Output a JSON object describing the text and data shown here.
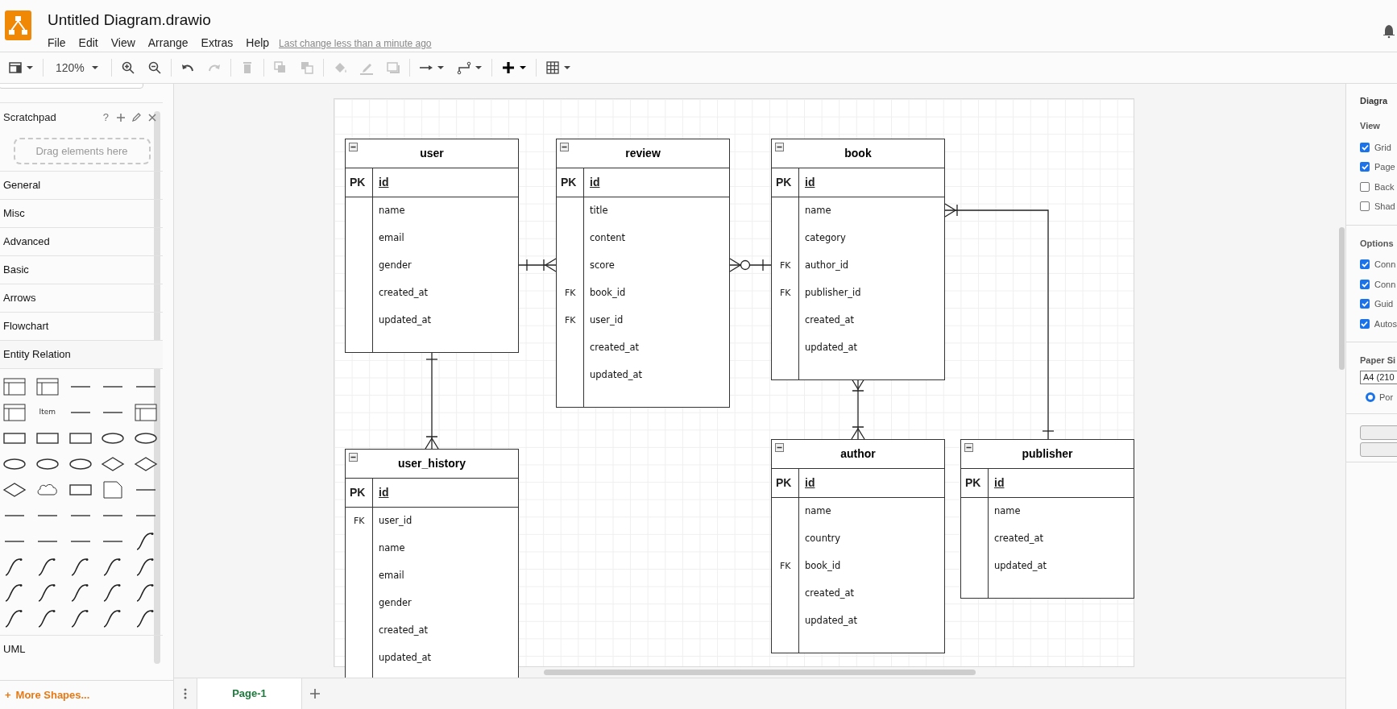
{
  "app": {
    "title": "Untitled Diagram.drawio",
    "menu": [
      "File",
      "Edit",
      "View",
      "Arrange",
      "Extras",
      "Help"
    ],
    "last_change": "Last change less than a minute ago"
  },
  "toolbar": {
    "zoom": "120%",
    "groups": [
      [
        {
          "kind": "layout",
          "disabled": false
        }
      ],
      [
        {
          "kind": "zoom-menu",
          "disabled": false
        }
      ],
      [
        {
          "kind": "zoom-in",
          "disabled": false
        },
        {
          "kind": "zoom-out",
          "disabled": false
        }
      ],
      [
        {
          "kind": "undo",
          "disabled": false
        },
        {
          "kind": "redo",
          "disabled": true
        }
      ],
      [
        {
          "kind": "delete",
          "disabled": true
        }
      ],
      [
        {
          "kind": "to-front",
          "disabled": true
        },
        {
          "kind": "to-back",
          "disabled": true
        }
      ],
      [
        {
          "kind": "fill",
          "disabled": true
        },
        {
          "kind": "line-color",
          "disabled": true
        },
        {
          "kind": "shadow",
          "disabled": true
        }
      ],
      [
        {
          "kind": "connection",
          "disabled": false
        },
        {
          "kind": "waypoints",
          "disabled": false
        }
      ],
      [
        {
          "kind": "insert",
          "disabled": false
        }
      ],
      [
        {
          "kind": "table",
          "disabled": false
        }
      ]
    ]
  },
  "sidebar": {
    "scratchpad": {
      "title": "Scratchpad",
      "help": "?",
      "drop_hint": "Drag elements here"
    },
    "categories": [
      {
        "label": "General",
        "expanded": false
      },
      {
        "label": "Misc",
        "expanded": false
      },
      {
        "label": "Advanced",
        "expanded": false
      },
      {
        "label": "Basic",
        "expanded": false
      },
      {
        "label": "Arrows",
        "expanded": false
      },
      {
        "label": "Flowchart",
        "expanded": false
      },
      {
        "label": "Entity Relation",
        "expanded": true
      },
      {
        "label": "UML",
        "expanded": false
      }
    ],
    "item_label": "Item",
    "more_shapes": "More Shapes...",
    "more_shapes_mark": "+"
  },
  "diagram": {
    "tables": [
      {
        "name": "user",
        "pk": {
          "key": "PK",
          "field": "id"
        },
        "columns": [
          {
            "field": "name"
          },
          {
            "field": "email"
          },
          {
            "field": "gender"
          },
          {
            "field": "created_at"
          },
          {
            "field": "updated_at"
          }
        ]
      },
      {
        "name": "review",
        "pk": {
          "key": "PK",
          "field": "id"
        },
        "columns": [
          {
            "field": "title"
          },
          {
            "field": "content"
          },
          {
            "field": "score"
          },
          {
            "key": "FK",
            "field": "book_id"
          },
          {
            "key": "FK",
            "field": "user_id"
          },
          {
            "field": "created_at"
          },
          {
            "field": "updated_at"
          }
        ]
      },
      {
        "name": "book",
        "pk": {
          "key": "PK",
          "field": "id"
        },
        "columns": [
          {
            "field": "name"
          },
          {
            "field": "category"
          },
          {
            "key": "FK",
            "field": "author_id"
          },
          {
            "key": "FK",
            "field": "publisher_id"
          },
          {
            "field": "created_at"
          },
          {
            "field": "updated_at"
          }
        ]
      },
      {
        "name": "user_history",
        "pk": {
          "key": "PK",
          "field": "id"
        },
        "columns": [
          {
            "key": "FK",
            "field": "user_id"
          },
          {
            "field": "name"
          },
          {
            "field": "email"
          },
          {
            "field": "gender"
          },
          {
            "field": "created_at"
          },
          {
            "field": "updated_at"
          }
        ]
      },
      {
        "name": "author",
        "pk": {
          "key": "PK",
          "field": "id"
        },
        "columns": [
          {
            "field": "name"
          },
          {
            "field": "country"
          },
          {
            "key": "FK",
            "field": "book_id"
          },
          {
            "field": "created_at"
          },
          {
            "field": "updated_at"
          }
        ]
      },
      {
        "name": "publisher",
        "pk": {
          "key": "PK",
          "field": "id"
        },
        "columns": [
          {
            "field": "name"
          },
          {
            "field": "created_at"
          },
          {
            "field": "updated_at"
          }
        ]
      }
    ],
    "relations": [
      {
        "ends": [
          {
            "kind": "one"
          },
          {
            "kind": "one-or-many"
          }
        ]
      },
      {
        "ends": [
          {
            "kind": "zero-or-many"
          },
          {
            "kind": "one"
          }
        ]
      },
      {
        "ends": [
          {
            "kind": "one"
          },
          {
            "kind": "one-or-many"
          }
        ]
      },
      {
        "ends": [
          {
            "kind": "one-or-many"
          },
          {
            "kind": "one-or-many"
          }
        ]
      },
      {
        "ends": [
          {
            "kind": "one-or-many"
          },
          {
            "kind": "one"
          }
        ]
      }
    ]
  },
  "format_panel": {
    "title": "Diagra",
    "sections": [
      {
        "title": "View",
        "options": [
          {
            "label": "Grid",
            "checked": true
          },
          {
            "label": "Page",
            "checked": true
          },
          {
            "label": "Back",
            "checked": false
          },
          {
            "label": "Shad",
            "checked": false
          }
        ]
      },
      {
        "title": "Options",
        "options": [
          {
            "label": "Conn",
            "checked": true
          },
          {
            "label": "Conn",
            "checked": true
          },
          {
            "label": "Guid",
            "checked": true
          },
          {
            "label": "Autos",
            "checked": true
          }
        ]
      }
    ],
    "paper": {
      "title": "Paper Si",
      "size": "A4 (210",
      "orientations": [
        {
          "label": "Por",
          "selected": true
        }
      ]
    }
  },
  "pages": [
    {
      "label": "Page-1",
      "selected": true
    }
  ]
}
